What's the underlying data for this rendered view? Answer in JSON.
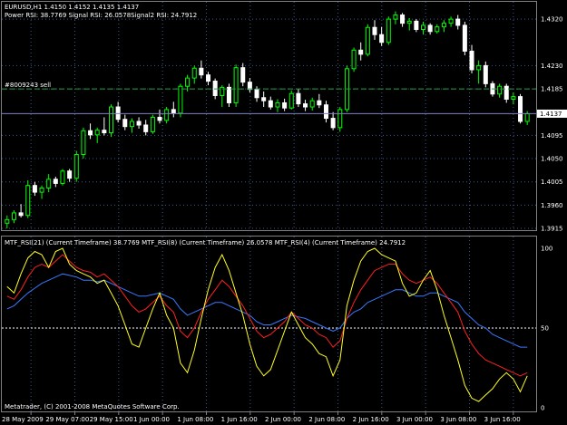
{
  "header": {
    "symbol_line": "EURUSD,H1  1.4150 1.4152 1.4135 1.4137",
    "indicator_line": "Power RSI: 38.7769 Signal RSI: 26.0578Signal2 RSI: 24.7912"
  },
  "order_label": "#8009243 sell",
  "price_axis": [
    "1.4320",
    "1.4230",
    "1.4185",
    "1.4095",
    "1.4050",
    "1.4005",
    "1.3960",
    "1.3915"
  ],
  "price_tag": "1.4137",
  "sub_header": "MTF_RSI(21) (Current Timeframe) 38.7769  MTF_RSI(8) (Current Timeframe) 26.0578  MTF_RSI(4) (Current Timeframe) 24.7912",
  "rsi_axis": [
    "100",
    "50",
    "0"
  ],
  "copyright": "Metatrader, (C) 2001-2008 MetaQuotes Software Corp.",
  "time_axis": [
    "28 May 2009",
    "29 May 07:00",
    "29 May 15:00",
    "1 Jun 00:00",
    "1 Jun 08:00",
    "1 Jun 16:00",
    "2 Jun 00:00",
    "2 Jun 08:00",
    "2 Jun 16:00",
    "3 Jun 00:00",
    "3 Jun 08:00",
    "3 Jun 16:00"
  ],
  "colors": {
    "background": "#000000",
    "bull_candle": "#00ff00",
    "bear_candle": "#ffffff",
    "grid": "#3a5a8a",
    "order_line": "#20a040",
    "rsi21": "#3a78ff",
    "rsi8": "#ff2020",
    "rsi4": "#ffff20",
    "level50": "#ffffff"
  },
  "chart_data": {
    "type": "candlestick",
    "price_range": [
      1.3915,
      1.435
    ],
    "order_level": 1.4185,
    "current_price": 1.4137,
    "candles": [
      [
        1.3925,
        1.394,
        1.3915,
        1.3932
      ],
      [
        1.3932,
        1.395,
        1.3925,
        1.3945
      ],
      [
        1.3945,
        1.3962,
        1.3936,
        1.394
      ],
      [
        1.394,
        1.4008,
        1.3935,
        1.3998
      ],
      [
        1.3998,
        1.4005,
        1.3978,
        1.3985
      ],
      [
        1.3985,
        1.3998,
        1.3972,
        1.3993
      ],
      [
        1.3993,
        1.402,
        1.3985,
        1.401
      ],
      [
        1.401,
        1.4015,
        1.3995,
        1.4002
      ],
      [
        1.4002,
        1.403,
        1.3998,
        1.4026
      ],
      [
        1.4026,
        1.403,
        1.4005,
        1.4012
      ],
      [
        1.4012,
        1.4065,
        1.4005,
        1.4058
      ],
      [
        1.4058,
        1.411,
        1.405,
        1.4104
      ],
      [
        1.4104,
        1.4118,
        1.4088,
        1.4096
      ],
      [
        1.4096,
        1.411,
        1.408,
        1.4105
      ],
      [
        1.4105,
        1.413,
        1.4095,
        1.41
      ],
      [
        1.41,
        1.4155,
        1.4092,
        1.415
      ],
      [
        1.415,
        1.416,
        1.412,
        1.4126
      ],
      [
        1.4126,
        1.4135,
        1.4105,
        1.4112
      ],
      [
        1.4112,
        1.4128,
        1.41,
        1.4122
      ],
      [
        1.4122,
        1.413,
        1.4108,
        1.4115
      ],
      [
        1.4115,
        1.4125,
        1.4095,
        1.4102
      ],
      [
        1.4102,
        1.4135,
        1.4098,
        1.413
      ],
      [
        1.413,
        1.4145,
        1.4118,
        1.4124
      ],
      [
        1.4124,
        1.415,
        1.4118,
        1.4145
      ],
      [
        1.4145,
        1.416,
        1.413,
        1.4138
      ],
      [
        1.4138,
        1.4195,
        1.413,
        1.419
      ],
      [
        1.419,
        1.4212,
        1.418,
        1.4206
      ],
      [
        1.4206,
        1.423,
        1.4195,
        1.4225
      ],
      [
        1.4225,
        1.424,
        1.4205,
        1.4212
      ],
      [
        1.4212,
        1.4218,
        1.4192,
        1.42
      ],
      [
        1.42,
        1.4205,
        1.4165,
        1.4172
      ],
      [
        1.4172,
        1.4192,
        1.415,
        1.4188
      ],
      [
        1.4188,
        1.4195,
        1.415,
        1.4158
      ],
      [
        1.4158,
        1.4232,
        1.415,
        1.4226
      ],
      [
        1.4226,
        1.4235,
        1.419,
        1.4198
      ],
      [
        1.4198,
        1.4206,
        1.4178,
        1.4184
      ],
      [
        1.4184,
        1.419,
        1.416,
        1.4168
      ],
      [
        1.4168,
        1.418,
        1.415,
        1.4162
      ],
      [
        1.4162,
        1.417,
        1.4145,
        1.415
      ],
      [
        1.415,
        1.4165,
        1.414,
        1.4158
      ],
      [
        1.4158,
        1.4166,
        1.4142,
        1.4148
      ],
      [
        1.4148,
        1.4182,
        1.4145,
        1.4176
      ],
      [
        1.4176,
        1.4185,
        1.415,
        1.4156
      ],
      [
        1.4156,
        1.4164,
        1.4142,
        1.415
      ],
      [
        1.415,
        1.4168,
        1.4143,
        1.4162
      ],
      [
        1.4162,
        1.4175,
        1.4148,
        1.4154
      ],
      [
        1.4154,
        1.4162,
        1.412,
        1.4128
      ],
      [
        1.4128,
        1.414,
        1.4105,
        1.411
      ],
      [
        1.411,
        1.415,
        1.4102,
        1.4145
      ],
      [
        1.4145,
        1.423,
        1.414,
        1.4224
      ],
      [
        1.4224,
        1.4265,
        1.4218,
        1.426
      ],
      [
        1.426,
        1.4275,
        1.424,
        1.4252
      ],
      [
        1.4252,
        1.431,
        1.4248,
        1.4304
      ],
      [
        1.4304,
        1.4318,
        1.428,
        1.429
      ],
      [
        1.429,
        1.4305,
        1.4268,
        1.4275
      ],
      [
        1.4275,
        1.4325,
        1.427,
        1.432
      ],
      [
        1.432,
        1.4335,
        1.431,
        1.4328
      ],
      [
        1.4328,
        1.4332,
        1.4305,
        1.4312
      ],
      [
        1.4312,
        1.4322,
        1.4298,
        1.4316
      ],
      [
        1.4316,
        1.432,
        1.4295,
        1.43
      ],
      [
        1.43,
        1.4315,
        1.429,
        1.4308
      ],
      [
        1.4308,
        1.4312,
        1.429,
        1.4296
      ],
      [
        1.4296,
        1.431,
        1.4292,
        1.4305
      ],
      [
        1.4305,
        1.4318,
        1.4295,
        1.4312
      ],
      [
        1.4312,
        1.4325,
        1.4305,
        1.432
      ],
      [
        1.432,
        1.4328,
        1.43,
        1.4308
      ],
      [
        1.4308,
        1.4315,
        1.425,
        1.4258
      ],
      [
        1.4258,
        1.427,
        1.4215,
        1.4222
      ],
      [
        1.4222,
        1.424,
        1.4195,
        1.423
      ],
      [
        1.423,
        1.4238,
        1.4188,
        1.4195
      ],
      [
        1.4195,
        1.42,
        1.417,
        1.4175
      ],
      [
        1.4175,
        1.4195,
        1.4168,
        1.419
      ],
      [
        1.419,
        1.4195,
        1.4158,
        1.4165
      ],
      [
        1.4165,
        1.4178,
        1.4155,
        1.417
      ],
      [
        1.417,
        1.4175,
        1.4118,
        1.4122
      ],
      [
        1.4122,
        1.4142,
        1.4115,
        1.4137
      ]
    ],
    "rsi_range": [
      0,
      100
    ],
    "rsi_levels": [
      50
    ],
    "rsi21": [
      62,
      64,
      68,
      72,
      75,
      78,
      80,
      82,
      84,
      83,
      82,
      80,
      80,
      79,
      80,
      78,
      76,
      74,
      72,
      70,
      70,
      71,
      72,
      70,
      68,
      62,
      58,
      60,
      62,
      64,
      66,
      66,
      64,
      62,
      60,
      58,
      54,
      52,
      52,
      54,
      56,
      58,
      57,
      56,
      54,
      52,
      50,
      48,
      50,
      56,
      60,
      62,
      66,
      68,
      70,
      72,
      74,
      74,
      72,
      70,
      70,
      72,
      72,
      70,
      68,
      66,
      60,
      56,
      52,
      50,
      46,
      44,
      42,
      40,
      38,
      38
    ],
    "rsi8": [
      70,
      68,
      74,
      82,
      88,
      90,
      88,
      92,
      96,
      92,
      88,
      86,
      85,
      82,
      84,
      80,
      76,
      70,
      64,
      60,
      62,
      66,
      70,
      64,
      60,
      48,
      44,
      50,
      60,
      68,
      74,
      80,
      76,
      70,
      64,
      56,
      48,
      44,
      46,
      50,
      54,
      60,
      56,
      52,
      50,
      46,
      44,
      38,
      42,
      56,
      66,
      74,
      80,
      86,
      88,
      90,
      90,
      84,
      80,
      78,
      80,
      82,
      78,
      72,
      66,
      60,
      48,
      40,
      34,
      30,
      28,
      26,
      24,
      22,
      20,
      22
    ],
    "rsi4": [
      76,
      72,
      84,
      94,
      98,
      96,
      88,
      98,
      100,
      90,
      86,
      84,
      82,
      78,
      80,
      72,
      64,
      52,
      40,
      38,
      50,
      62,
      72,
      58,
      50,
      28,
      22,
      36,
      56,
      74,
      88,
      96,
      86,
      72,
      58,
      40,
      26,
      20,
      24,
      36,
      48,
      60,
      52,
      44,
      40,
      34,
      32,
      20,
      30,
      64,
      80,
      92,
      98,
      100,
      96,
      94,
      92,
      78,
      70,
      72,
      80,
      86,
      74,
      58,
      44,
      30,
      14,
      6,
      4,
      8,
      12,
      18,
      22,
      18,
      10,
      20
    ]
  }
}
